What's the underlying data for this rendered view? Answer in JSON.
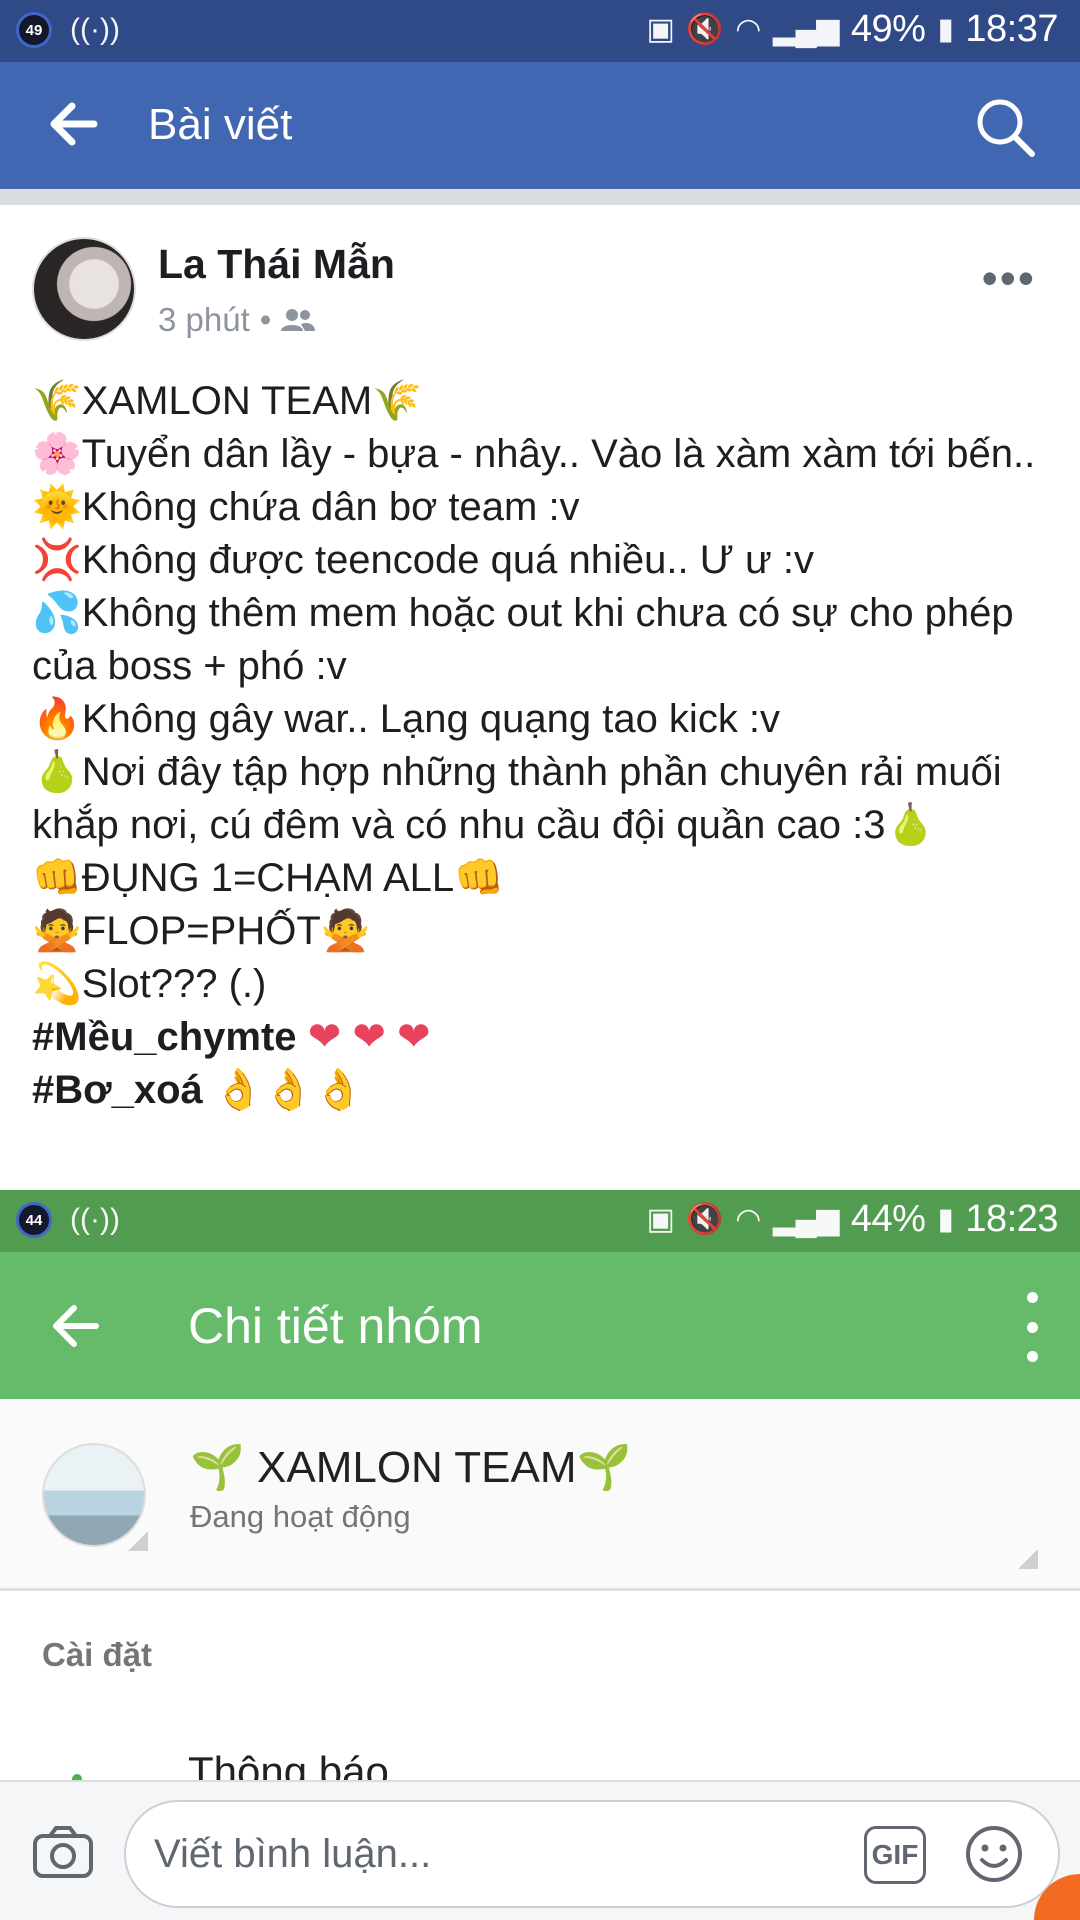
{
  "top_status_bar": {
    "notification_count": "49",
    "battery": "49%",
    "time": "18:37"
  },
  "fb_appbar": {
    "title": "Bài viết"
  },
  "post": {
    "author": "La Thái Mẫn",
    "time": "3 phút",
    "separator": "•",
    "more": "•••",
    "lines": [
      "🌾XAMLON TEAM🌾",
      "🌸Tuyển dân lầy - bựa - nhây..  Vào là xàm xàm tới bến..",
      "🌞Không chứa dân bơ team :v",
      "💢Không được teencode quá nhiều.. Ư ư :v",
      "💦Không thêm mem hoặc out khi chưa có sự cho phép của boss + phó :v",
      "🔥Không gây war.. Lạng quạng tao kick :v",
      "🍐Nơi đây tập hợp những thành phần chuyên rải muối khắp nơi, cú đêm và có nhu cầu đội quần cao :3🍐",
      "👊ĐỤNG 1=CHẠM ALL👊",
      "🙅FLOP=PHỐT🙅",
      "💫Slot??? (.)"
    ],
    "hashtag1": "#Mều_chymte",
    "hashtag1_emoji": "❤ ❤ ❤",
    "hashtag2": "#Bơ_xoá",
    "hashtag2_emoji": "👌👌👌"
  },
  "second_status_bar": {
    "notification_count": "44",
    "battery": "44%",
    "time": "18:23"
  },
  "group_appbar": {
    "title": "Chi tiết nhóm"
  },
  "group": {
    "name": "🌱 XAMLON TEAM🌱",
    "status": "Đang hoạt động"
  },
  "settings": {
    "section_label": "Cài đặt",
    "first_item": "Thông báo"
  },
  "comment_bar": {
    "placeholder": "Viết bình luận...",
    "gif_label": "GIF"
  },
  "colors": {
    "facebook_blue": "#4267b2",
    "status_blue": "#2f4a87",
    "messenger_green": "#66bb6a",
    "status_green": "#529c52"
  }
}
